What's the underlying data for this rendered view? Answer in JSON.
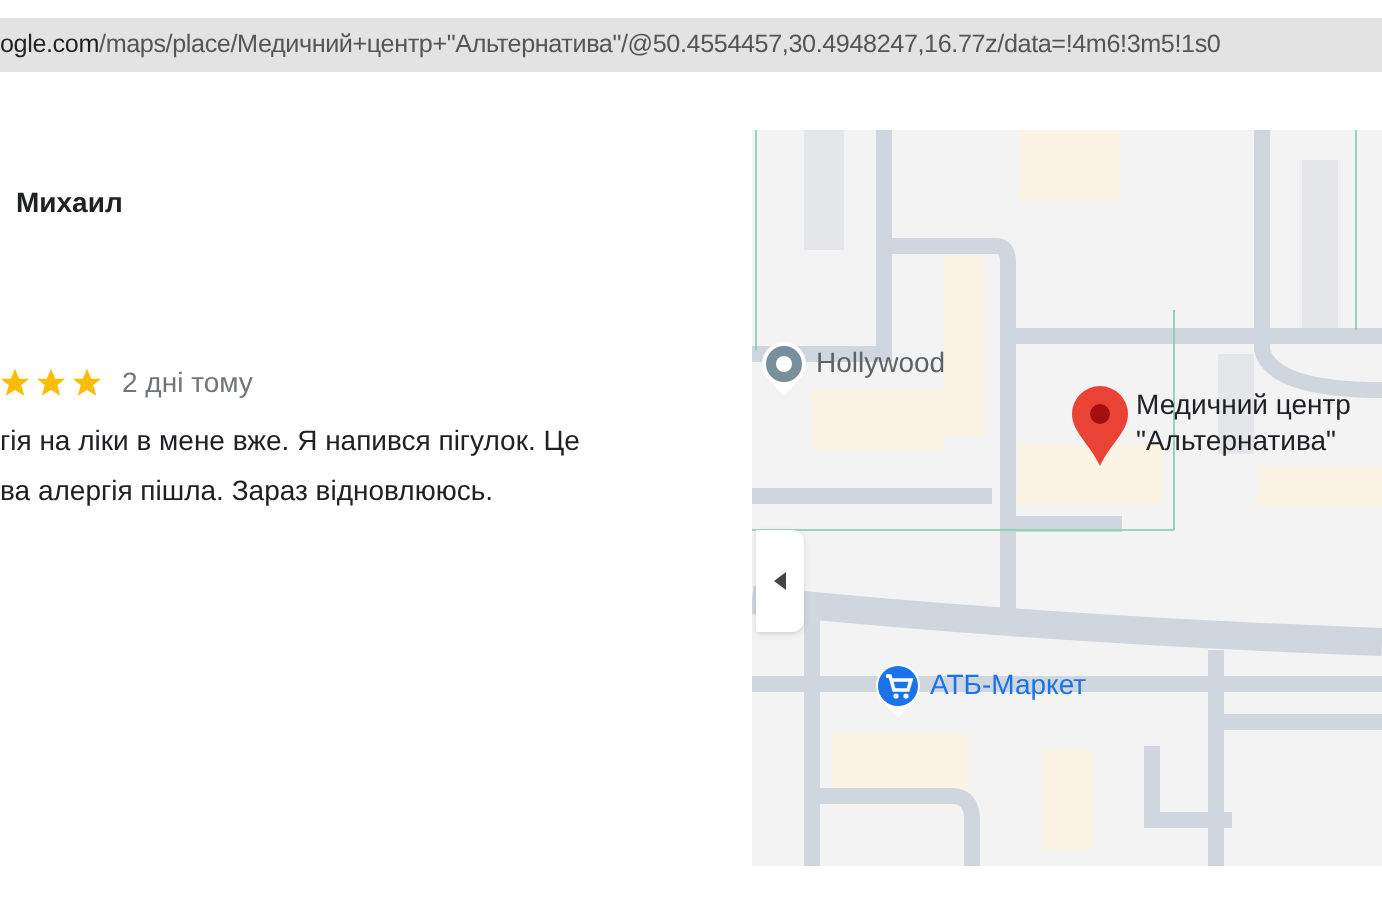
{
  "address_bar": {
    "url_host": "ogle.com",
    "url_path": "/maps/place/Медичний+центр+\"Альтернатива\"/@50.4554457,30.4948247,16.77z/data=!4m6!3m5!1s0"
  },
  "review": {
    "author": "Михаил",
    "stars": 3,
    "time": "2 дні тому",
    "lines": [
      "гія на ліки в мене вже. Я напився пігулок. Це",
      "ва алергія пішла. Зараз відновлююсь."
    ]
  },
  "map": {
    "markers": [
      {
        "kind": "poi",
        "label": "Hollywood"
      },
      {
        "kind": "pin",
        "label_lines": [
          "Медичний центр",
          "\"Альтернатива\""
        ]
      },
      {
        "kind": "shop",
        "label": "АТБ-Маркет"
      }
    ]
  }
}
